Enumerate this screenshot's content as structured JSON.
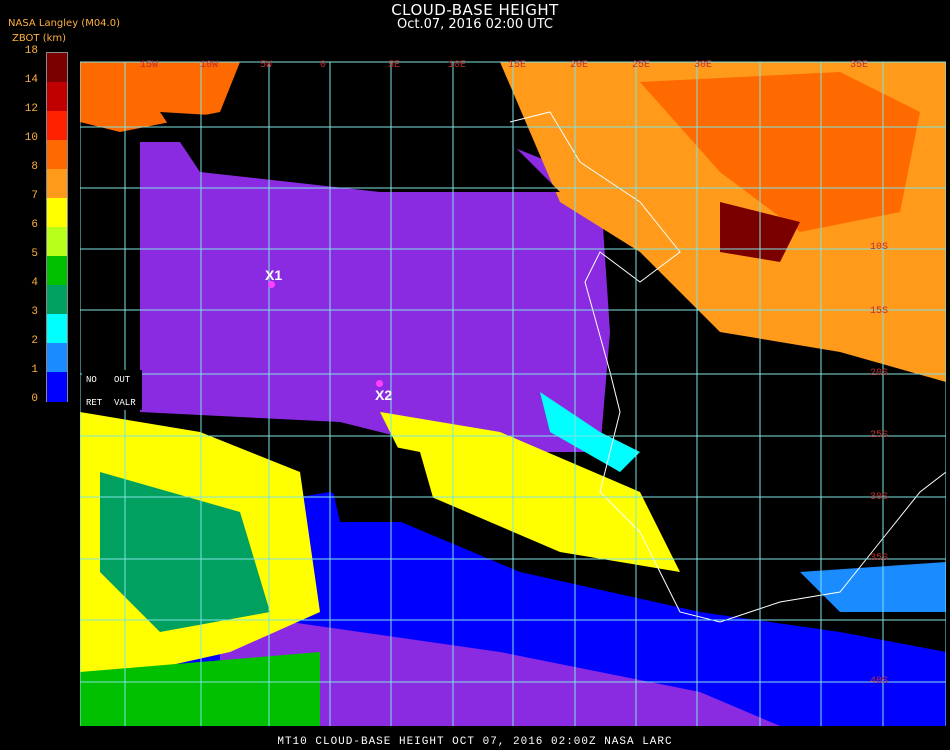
{
  "header": {
    "title": "CLOUD-BASE HEIGHT",
    "subtitle": "Oct.07, 2016 02:00 UTC",
    "brand": "NASA Langley (M04.0)",
    "unit": "ZBOT (km)"
  },
  "legend": {
    "ticks": [
      "18",
      "14",
      "12",
      "10",
      "8",
      "7",
      "6",
      "5",
      "4",
      "3",
      "2",
      "1",
      "0"
    ],
    "colors": [
      "#7a0000",
      "#c00000",
      "#ff2000",
      "#ff6a00",
      "#ff9a1a",
      "#ffff00",
      "#b8ff1a",
      "#00c000",
      "#00a060",
      "#00ffff",
      "#1a8cff",
      "#0000ff",
      "#8a2be2"
    ]
  },
  "status_box": {
    "no": "NO",
    "out": "OUT",
    "ret": "RET",
    "valr": "VALR"
  },
  "markers": [
    {
      "label": "X1"
    },
    {
      "label": "X2"
    }
  ],
  "grid": {
    "lon_labels": [
      "15W",
      "10W",
      "5W",
      "0",
      "5E",
      "10E",
      "15E",
      "20E",
      "25E",
      "30E",
      "35E"
    ],
    "lat_labels": [
      "10S",
      "15S",
      "20S",
      "25S",
      "30S",
      "35S",
      "40S"
    ]
  },
  "footer": "MT10  CLOUD-BASE HEIGHT  OCT 07, 2016 02:00Z  NASA LARC"
}
